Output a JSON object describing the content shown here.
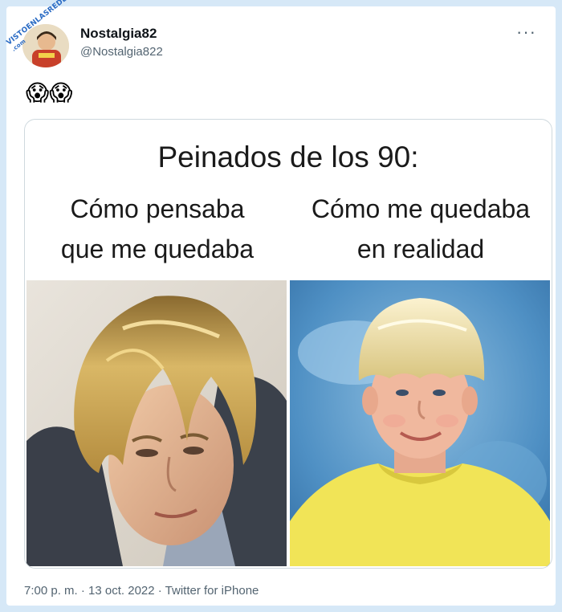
{
  "tweet": {
    "display_name": "Nostalgia82",
    "handle": "@Nostalgia822",
    "emojis": "😱😱",
    "more_icon": "more-horizontal-icon",
    "timestamp": "7:00 p. m. · 13 oct. 2022 · Twitter for iPhone"
  },
  "watermark": {
    "text": "VISTOENLASREDES",
    "sub": ".com"
  },
  "meme": {
    "title": "Peinados de los 90:",
    "left_caption_line1": "Cómo pensaba",
    "left_caption_line2": "que me quedaba",
    "right_caption_line1": "Cómo me quedaba",
    "right_caption_line2": "en realidad"
  },
  "colors": {
    "background": "#d6e8f7",
    "text_primary": "#0f1419",
    "text_secondary": "#536471",
    "border": "#cfd9de"
  }
}
